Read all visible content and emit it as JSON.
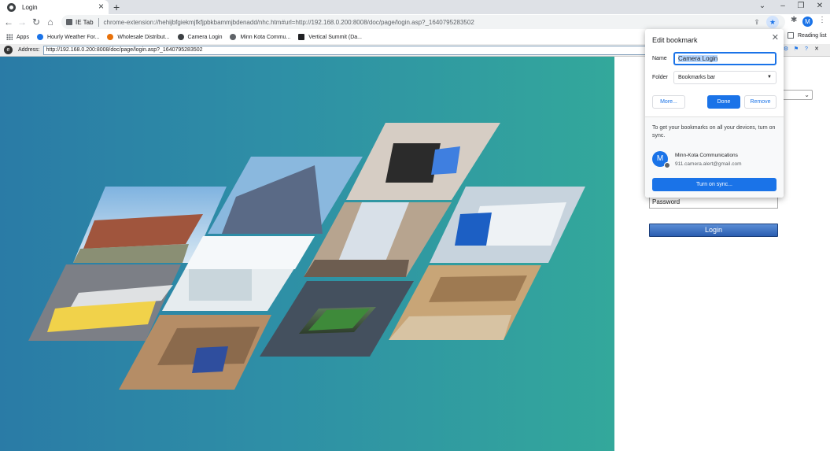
{
  "tab": {
    "title": "Login",
    "close": "×",
    "new_tab": "+"
  },
  "window_controls": {
    "dropdown": "⌄",
    "minimize": "–",
    "maximize": "❐",
    "close": "✕"
  },
  "omnibox": {
    "ext_label": "IE Tab",
    "url": "chrome-extension://hehijbfgiekmjfkfjpbkbammjbdenadd/nhc.htm#url=http://192.168.0.200:8008/doc/page/login.asp?_1640795283502"
  },
  "avatar_letter": "M",
  "bookmarks": [
    {
      "label": "Apps",
      "icon": "apps-grid-icon"
    },
    {
      "label": "Hourly Weather For...",
      "icon": "weather-icon",
      "color": "#1a73e8"
    },
    {
      "label": "Wholesale Distribut...",
      "icon": "distributor-icon",
      "color": "#e8710a"
    },
    {
      "label": "Camera Login",
      "icon": "camera-login-icon",
      "color": "#3c4043"
    },
    {
      "label": "Minn Kota Commu...",
      "icon": "minnkota-icon",
      "color": "#5f6368"
    },
    {
      "label": "Vertical Summit (Da...",
      "icon": "summit-icon",
      "color": "#202124"
    }
  ],
  "reading_list": "Reading list",
  "ie_bar": {
    "label": "Address:",
    "address": "http://192.168.0.200:8008/doc/page/login.asp?_1640795283502"
  },
  "login": {
    "password_placeholder": "Password",
    "login_label": "Login"
  },
  "bookmark_dialog": {
    "title": "Edit bookmark",
    "name_label": "Name",
    "name_value": "Camera Login",
    "folder_label": "Folder",
    "folder_value": "Bookmarks bar",
    "more": "More...",
    "done": "Done",
    "remove": "Remove",
    "sync_text": "To get your bookmarks on all your devices, turn on sync.",
    "account_name": "Minn-Kota Communications",
    "account_email": "911.camera.alert@gmail.com",
    "sync_button": "Turn on sync..."
  },
  "colors": {
    "accent": "#1a73e8",
    "hero_left": "#2a7ba6",
    "hero_right": "#33a89b"
  }
}
